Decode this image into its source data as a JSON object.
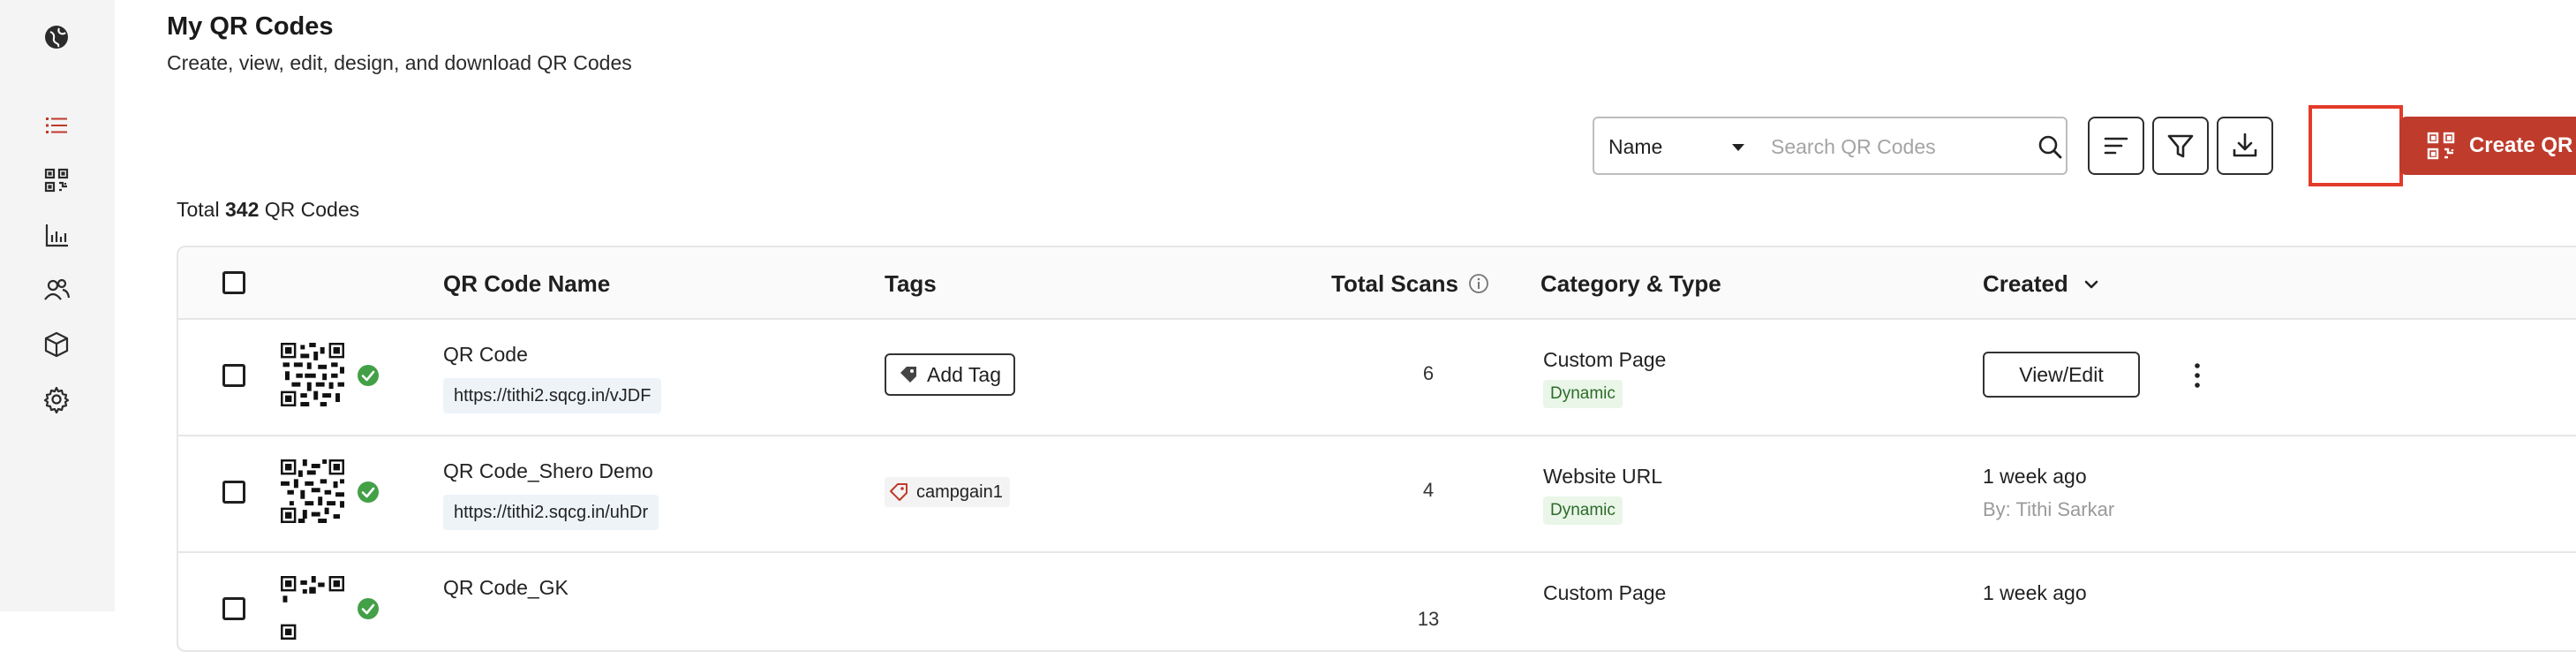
{
  "header": {
    "title": "My QR Codes",
    "subtitle": "Create, view, edit, design, and download QR Codes"
  },
  "sidebar": {
    "items": [
      {
        "icon": "globe-icon"
      },
      {
        "icon": "list-icon",
        "active": true
      },
      {
        "icon": "qr-icon"
      },
      {
        "icon": "bar-chart-icon"
      },
      {
        "icon": "users-icon"
      },
      {
        "icon": "cube-icon"
      },
      {
        "icon": "gear-icon"
      }
    ]
  },
  "toolbar": {
    "search_field": "Name",
    "search_placeholder": "Search QR Codes",
    "create_label": "Create QR Code"
  },
  "summary": {
    "prefix": "Total",
    "count": "342",
    "suffix": "QR Codes"
  },
  "table": {
    "columns": {
      "name": "QR Code Name",
      "tags": "Tags",
      "scans": "Total Scans",
      "category": "Category & Type",
      "created": "Created"
    },
    "rows": [
      {
        "name": "QR Code",
        "url": "https://tithi2.sqcg.in/vJDF",
        "tag_action": "Add Tag",
        "scans": "6",
        "category": "Custom Page",
        "type": "Dynamic",
        "action": "View/Edit"
      },
      {
        "name": "QR Code_Shero Demo",
        "url": "https://tithi2.sqcg.in/uhDr",
        "tag": "campgain1",
        "scans": "4",
        "category": "Website URL",
        "type": "Dynamic",
        "created": "1 week ago",
        "created_by": "By: Tithi Sarkar"
      },
      {
        "name": "QR Code_GK",
        "scans": "13",
        "category": "Custom Page",
        "created": "1 week ago"
      }
    ]
  },
  "colors": {
    "accent": "#bf3b2c",
    "highlight": "#e33b2a",
    "success": "#43a047",
    "sidebar_bg": "#f4f4f4"
  }
}
